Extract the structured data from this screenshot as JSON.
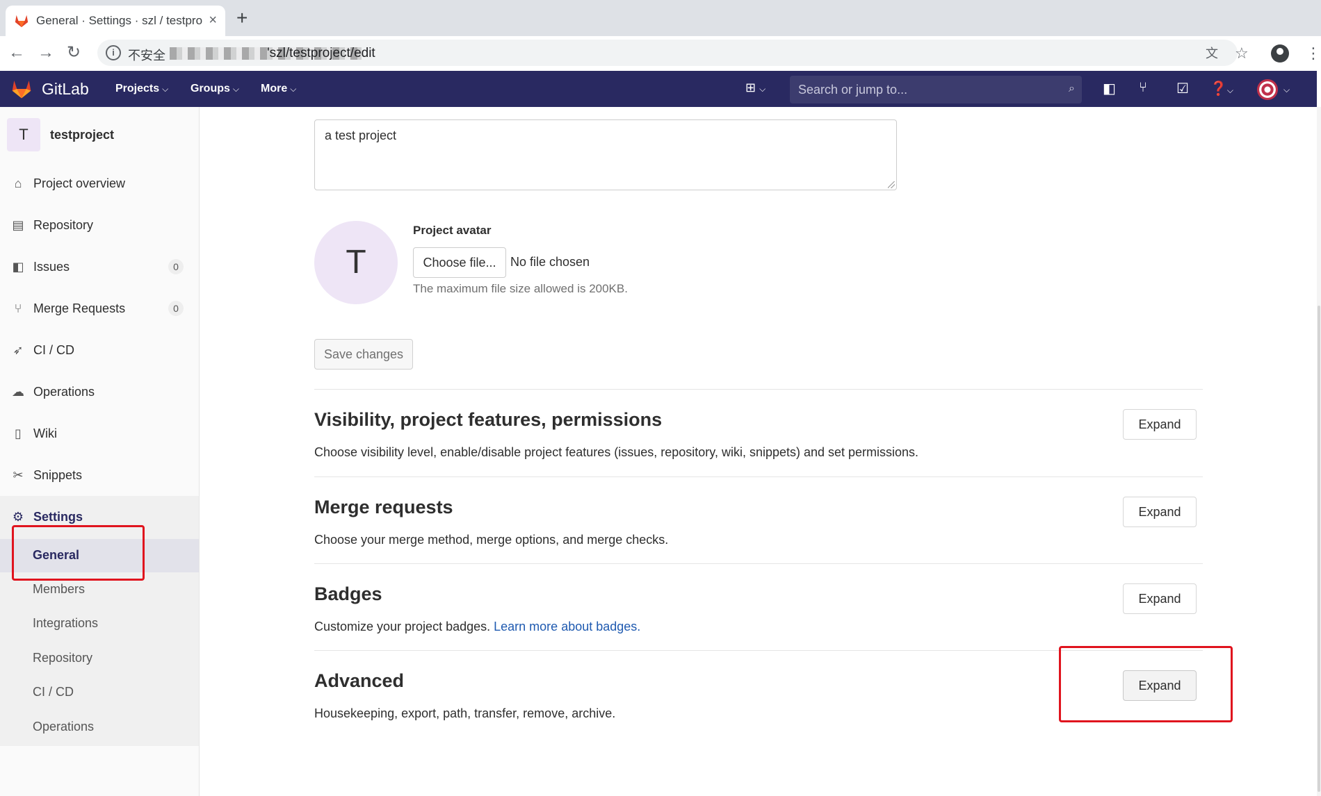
{
  "browser": {
    "tab_title": "General · Settings · szl / testpro",
    "tab_close": "×",
    "new_tab": "+",
    "insecure_label": "不安全",
    "url_path": "szl/testproject/edit"
  },
  "header": {
    "brand": "GitLab",
    "nav": [
      "Projects",
      "Groups",
      "More"
    ],
    "search_placeholder": "Search or jump to...",
    "bg_color": "#292961"
  },
  "sidebar": {
    "project_initial": "T",
    "project_name": "testproject",
    "items": [
      {
        "label": "Project overview",
        "icon": "home-icon"
      },
      {
        "label": "Repository",
        "icon": "document-icon"
      },
      {
        "label": "Issues",
        "icon": "issues-icon",
        "count": "0"
      },
      {
        "label": "Merge Requests",
        "icon": "merge-request-icon",
        "count": "0"
      },
      {
        "label": "CI / CD",
        "icon": "rocket-icon"
      },
      {
        "label": "Operations",
        "icon": "cloud-icon"
      },
      {
        "label": "Wiki",
        "icon": "book-icon"
      },
      {
        "label": "Snippets",
        "icon": "scissors-icon"
      },
      {
        "label": "Settings",
        "icon": "gear-icon"
      }
    ],
    "settings_sub": [
      "General",
      "Members",
      "Integrations",
      "Repository",
      "CI / CD",
      "Operations"
    ]
  },
  "main": {
    "description": "a test project",
    "avatar_initial": "T",
    "avatar_label": "Project avatar",
    "choose_file": "Choose file...",
    "no_file": "No file chosen",
    "max_size": "The maximum file size allowed is 200KB.",
    "save": "Save changes",
    "expand_label": "Expand",
    "sections": [
      {
        "title": "Visibility, project features, permissions",
        "desc": "Choose visibility level, enable/disable project features (issues, repository, wiki, snippets) and set permissions."
      },
      {
        "title": "Merge requests",
        "desc": "Choose your merge method, merge options, and merge checks."
      },
      {
        "title": "Badges",
        "desc": "Customize your project badges. ",
        "link": "Learn more about badges."
      },
      {
        "title": "Advanced",
        "desc": "Housekeeping, export, path, transfer, remove, archive."
      }
    ]
  }
}
